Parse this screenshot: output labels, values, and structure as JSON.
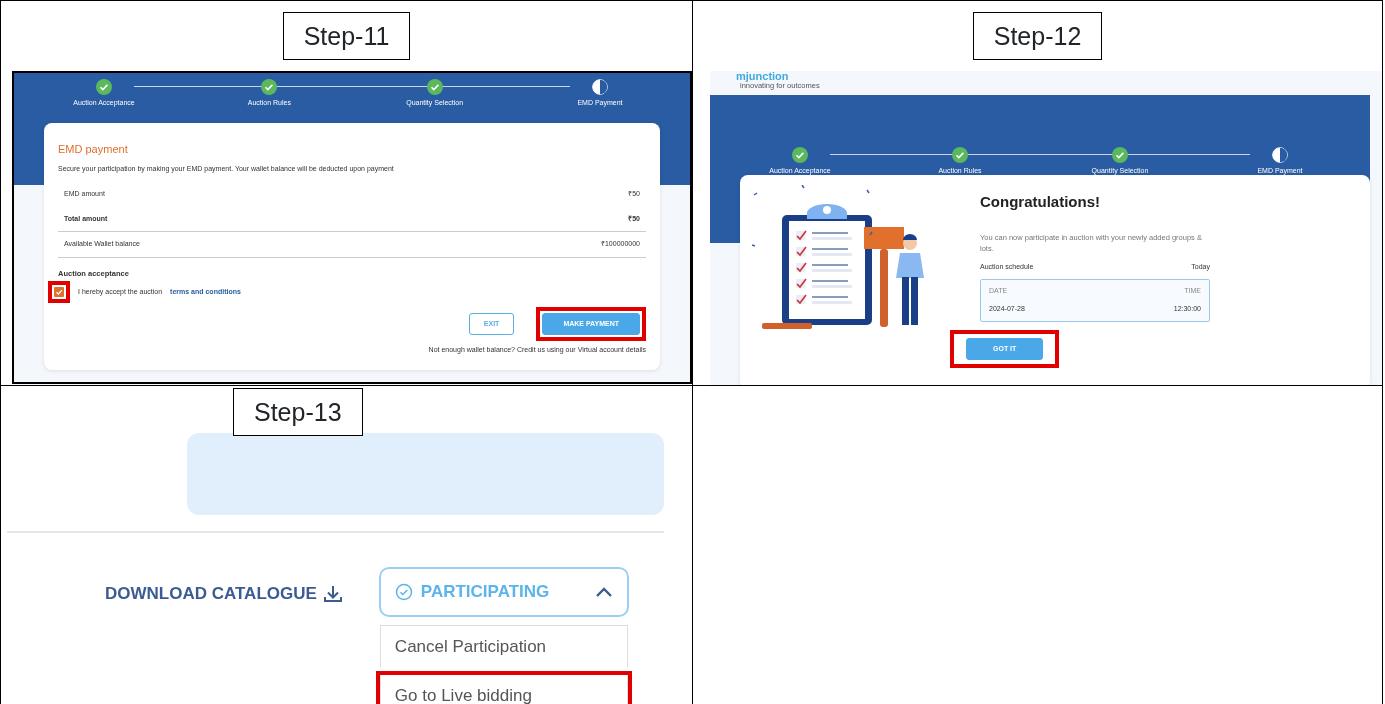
{
  "step_11": {
    "label": "Step-11",
    "stepper": [
      {
        "label": "Auction Acceptance",
        "done": true
      },
      {
        "label": "Auction Rules",
        "done": true
      },
      {
        "label": "Quantity Selection",
        "done": true
      },
      {
        "label": "EMD Payment",
        "done": false
      }
    ],
    "title": "EMD payment",
    "intro": "Secure your participation by making your EMD payment. Your wallet balance will be deducted upon payment",
    "rows": [
      {
        "label": "EMD amount",
        "value": "₹50",
        "bold": false
      },
      {
        "label": "Total amount",
        "value": "₹50",
        "bold": true
      },
      {
        "label": "Available Wallet balance",
        "value": "₹100000000",
        "bold": false
      }
    ],
    "acceptance_heading": "Auction acceptance",
    "accept": {
      "checked": true,
      "highlighted": true,
      "text": "I hereby accept the auction",
      "link": "terms and conditions"
    },
    "buttons": [
      {
        "label": "EXIT",
        "kind": "outline",
        "highlighted": false
      },
      {
        "label": "MAKE PAYMENT",
        "kind": "primary",
        "highlighted": true
      }
    ],
    "note": "Not enough wallet balance? Credit us using our Virtual account details"
  },
  "step_12": {
    "label": "Step-12",
    "logo": "mjunction",
    "tagline": "innovating for outcomes",
    "stepper": [
      {
        "label": "Auction Acceptance",
        "done": true
      },
      {
        "label": "Auction Rules",
        "done": true
      },
      {
        "label": "Quantity Selection",
        "done": true
      },
      {
        "label": "EMD Payment",
        "done": false
      }
    ],
    "title": "Congratulations!",
    "message": "You can now participate in auction with your newly added groups & lots.",
    "schedule_label": "Auction schedule",
    "schedule_day": "Today",
    "schedule": {
      "date_label": "DATE",
      "time_label": "TIME",
      "date": "2024-07-28",
      "time": "12:30:00"
    },
    "button": {
      "label": "GOT IT",
      "highlighted": true
    }
  },
  "step_13": {
    "label": "Step-13",
    "download": "DOWNLOAD CATALOGUE",
    "dropdown": {
      "label": "PARTICIPATING",
      "expanded": true,
      "items": [
        {
          "label": "Cancel Participation",
          "highlighted": false
        },
        {
          "label": "Go to Live bidding",
          "highlighted": true
        }
      ]
    }
  }
}
